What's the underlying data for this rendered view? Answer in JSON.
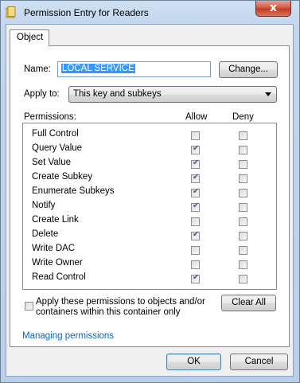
{
  "window": {
    "title": "Permission Entry for Readers",
    "close_label": "x"
  },
  "tabs": [
    {
      "label": "Object"
    }
  ],
  "name_field": {
    "label": "Name:",
    "value": "LOCAL SERVICE",
    "change_label": "Change..."
  },
  "apply_to": {
    "label": "Apply to:",
    "value": "This key and subkeys"
  },
  "permissions": {
    "header": "Permissions:",
    "allow_header": "Allow",
    "deny_header": "Deny",
    "rows": [
      {
        "name": "Full Control",
        "allow": false,
        "deny": false
      },
      {
        "name": "Query Value",
        "allow": true,
        "deny": false
      },
      {
        "name": "Set Value",
        "allow": true,
        "deny": false
      },
      {
        "name": "Create Subkey",
        "allow": true,
        "deny": false
      },
      {
        "name": "Enumerate Subkeys",
        "allow": true,
        "deny": false
      },
      {
        "name": "Notify",
        "allow": true,
        "deny": false
      },
      {
        "name": "Create Link",
        "allow": false,
        "deny": false
      },
      {
        "name": "Delete",
        "allow": true,
        "deny": false
      },
      {
        "name": "Write DAC",
        "allow": false,
        "deny": false
      },
      {
        "name": "Write Owner",
        "allow": false,
        "deny": false
      },
      {
        "name": "Read Control",
        "allow": true,
        "deny": false
      }
    ]
  },
  "apply_children": {
    "label_line1": "Apply these permissions to objects and/or",
    "label_line2": "containers within this container only",
    "checked": false
  },
  "clear_all_label": "Clear All",
  "managing_link": "Managing permissions",
  "ok_label": "OK",
  "cancel_label": "Cancel"
}
